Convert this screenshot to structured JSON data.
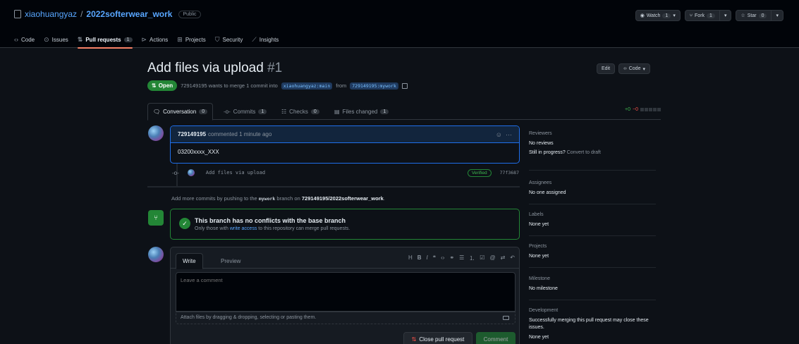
{
  "repo": {
    "owner": "xiaohuangyaz",
    "sep": "/",
    "name": "2022softerwear_work",
    "visibility": "Public"
  },
  "repo_actions": {
    "watch_label": "Watch",
    "watch_count": "1",
    "fork_label": "Fork",
    "fork_count": "1",
    "star_label": "Star",
    "star_count": "0"
  },
  "nav": {
    "code": "Code",
    "issues": "Issues",
    "pulls": "Pull requests",
    "pulls_count": "1",
    "actions": "Actions",
    "projects": "Projects",
    "security": "Security",
    "insights": "Insights"
  },
  "pr": {
    "title": "Add files via upload",
    "number": "#1",
    "edit_label": "Edit",
    "code_label": "Code",
    "state": "Open",
    "meta_prefix": "729149195 wants to merge 1 commit into",
    "base_branch": "xiaohuangyaz:main",
    "meta_from": "from",
    "head_branch": "729149195:mywork"
  },
  "tabs": {
    "conversation": "Conversation",
    "conversation_count": "0",
    "commits": "Commits",
    "commits_count": "1",
    "checks": "Checks",
    "checks_count": "0",
    "files": "Files changed",
    "files_count": "1",
    "additions": "+0",
    "deletions": "−0"
  },
  "comment": {
    "author": "729149195",
    "ago": "commented 1 minute ago",
    "body": "03200xxxx_XXX"
  },
  "commit": {
    "message": "Add files via upload",
    "verified": "Verified",
    "sha": "77f3687"
  },
  "push_hint": {
    "prefix": "Add more commits by pushing to the",
    "branch": "mywork",
    "middle": "branch on",
    "repo": "729149195/2022softerwear_work",
    "suffix": "."
  },
  "merge": {
    "title": "This branch has no conflicts with the base branch",
    "sub_prefix": "Only those with",
    "sub_link": "write access",
    "sub_suffix": "to this repository can merge pull requests."
  },
  "editor": {
    "write_tab": "Write",
    "preview_tab": "Preview",
    "placeholder": "Leave a comment",
    "attach_hint": "Attach files by dragging & dropping, selecting or pasting them.",
    "close_label": "Close pull request",
    "comment_label": "Comment"
  },
  "sidebar": {
    "reviewers_title": "Reviewers",
    "reviewers_value": "No reviews",
    "in_progress": "Still in progress?",
    "convert_draft": "Convert to draft",
    "assignees_title": "Assignees",
    "assignees_value": "No one assigned",
    "labels_title": "Labels",
    "labels_value": "None yet",
    "projects_title": "Projects",
    "projects_value": "None yet",
    "milestone_title": "Milestone",
    "milestone_value": "No milestone",
    "development_title": "Development",
    "development_value": "Successfully merging this pull request may close these issues.",
    "development_none": "None yet"
  },
  "colors": {
    "background": "#0d1117",
    "accent_green": "#238636",
    "link_blue": "#58a6ff",
    "tab_underline": "#f78166"
  }
}
